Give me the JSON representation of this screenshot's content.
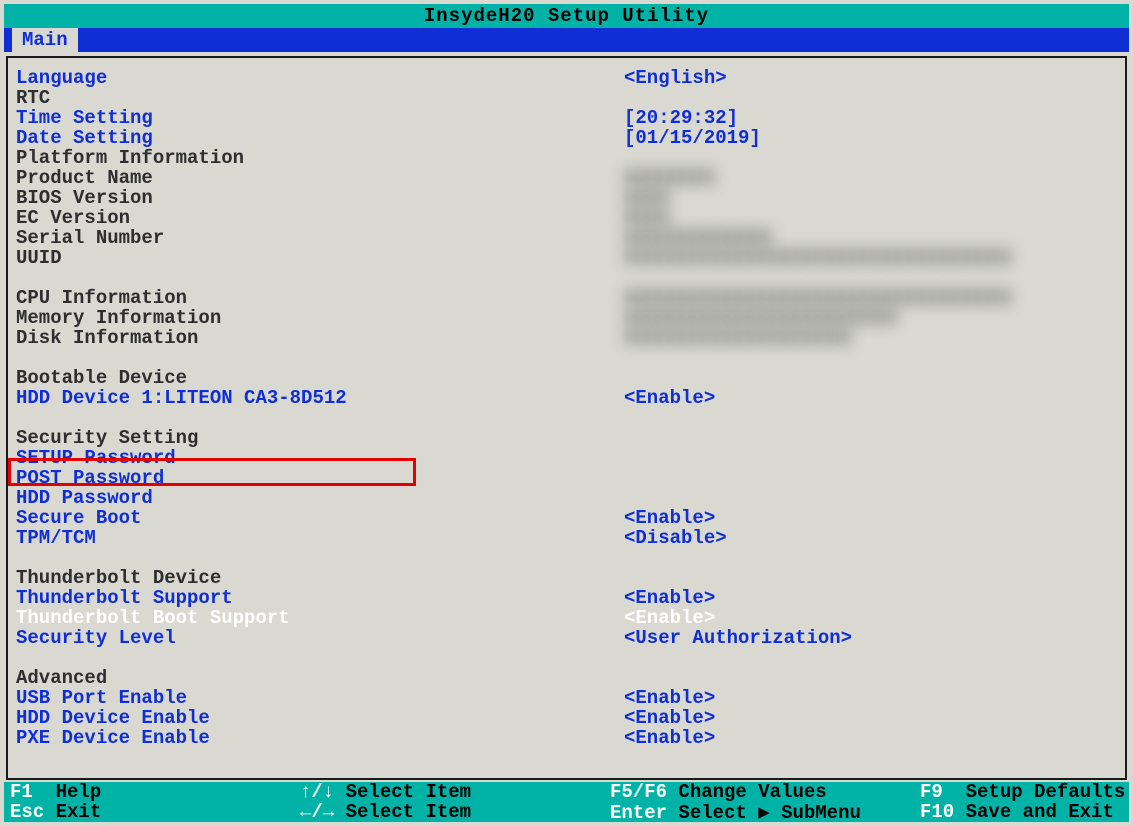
{
  "title": "InsydeH20 Setup Utility",
  "tab": "Main",
  "rows": [
    {
      "label": "Language",
      "value": "<English>",
      "labelClass": "c-blue",
      "valueClass": "c-blue",
      "interact": true
    },
    {
      "label": "RTC",
      "value": "",
      "labelClass": "c-gray",
      "valueClass": "c-gray",
      "interact": false
    },
    {
      "label": "Time Setting",
      "value": "[20:29:32]",
      "labelClass": "c-blue",
      "valueClass": "c-blue",
      "interact": true
    },
    {
      "label": "Date Setting",
      "value": "[01/15/2019]",
      "labelClass": "c-blue",
      "valueClass": "c-blue",
      "interact": true
    },
    {
      "label": "Platform Information",
      "value": "",
      "labelClass": "c-gray",
      "valueClass": "c-gray",
      "interact": false
    },
    {
      "label": "Product Name",
      "value": "XXXXXXXX",
      "labelClass": "c-gray",
      "valueClass": "blur",
      "interact": false
    },
    {
      "label": "BIOS Version",
      "value": "XXXX",
      "labelClass": "c-gray",
      "valueClass": "blur",
      "interact": false
    },
    {
      "label": "EC Version",
      "value": "XXXX",
      "labelClass": "c-gray",
      "valueClass": "blur",
      "interact": false
    },
    {
      "label": "Serial Number",
      "value": "XXXXXXXXXXXXX",
      "labelClass": "c-gray",
      "valueClass": "blur",
      "interact": false
    },
    {
      "label": "UUID",
      "value": "XXXXXXXXXXXXXXXXXXXXXXXXXXXXXXXXXX",
      "labelClass": "c-gray",
      "valueClass": "blur",
      "interact": false
    },
    {
      "label": "",
      "value": "",
      "labelClass": "c-gray",
      "valueClass": "c-gray",
      "interact": false
    },
    {
      "label": "CPU Information",
      "value": "XXXXXXXXXXXXXXXXXXXXXXXXXXXXXXXXXX",
      "labelClass": "c-gray",
      "valueClass": "blur",
      "interact": false
    },
    {
      "label": "Memory Information",
      "value": "XXXXXXXXXXXXXXXXXXXXXXXX",
      "labelClass": "c-gray",
      "valueClass": "blur",
      "interact": false
    },
    {
      "label": "Disk Information",
      "value": "XXXXXXXXXXXXXXXXXXXX",
      "labelClass": "c-gray",
      "valueClass": "blur",
      "interact": false
    },
    {
      "label": "",
      "value": "",
      "labelClass": "c-gray",
      "valueClass": "c-gray",
      "interact": false
    },
    {
      "label": "Bootable Device",
      "value": "",
      "labelClass": "c-gray",
      "valueClass": "c-gray",
      "interact": false
    },
    {
      "label": "HDD Device 1:LITEON CA3-8D512",
      "value": "<Enable>",
      "labelClass": "c-blue",
      "valueClass": "c-blue",
      "interact": true
    },
    {
      "label": "",
      "value": "",
      "labelClass": "c-gray",
      "valueClass": "c-gray",
      "interact": false
    },
    {
      "label": "Security Setting",
      "value": "",
      "labelClass": "c-gray",
      "valueClass": "c-gray",
      "interact": false
    },
    {
      "label": "SETUP Password",
      "value": "",
      "labelClass": "c-blue",
      "valueClass": "c-blue",
      "interact": true
    },
    {
      "label": "POST Password",
      "value": "",
      "labelClass": "c-blue",
      "valueClass": "c-blue",
      "interact": true
    },
    {
      "label": "HDD Password",
      "value": "",
      "labelClass": "c-blue",
      "valueClass": "c-blue",
      "interact": true
    },
    {
      "label": "Secure Boot",
      "value": "<Enable>",
      "labelClass": "c-blue",
      "valueClass": "c-blue",
      "interact": true
    },
    {
      "label": "TPM/TCM",
      "value": "<Disable>",
      "labelClass": "c-blue",
      "valueClass": "c-blue",
      "interact": true
    },
    {
      "label": "",
      "value": "",
      "labelClass": "c-gray",
      "valueClass": "c-gray",
      "interact": false
    },
    {
      "label": "Thunderbolt Device",
      "value": "",
      "labelClass": "c-gray",
      "valueClass": "c-gray",
      "interact": false
    },
    {
      "label": "Thunderbolt Support",
      "value": "<Enable>",
      "labelClass": "c-blue",
      "valueClass": "c-blue",
      "interact": true
    },
    {
      "label": "Thunderbolt Boot Support",
      "value": "<Enable>",
      "labelClass": "c-white",
      "valueClass": "c-white",
      "interact": true
    },
    {
      "label": "Security Level",
      "value": "<User Authorization>",
      "labelClass": "c-blue",
      "valueClass": "c-blue",
      "interact": true
    },
    {
      "label": "",
      "value": "",
      "labelClass": "c-gray",
      "valueClass": "c-gray",
      "interact": false
    },
    {
      "label": "Advanced",
      "value": "",
      "labelClass": "c-gray",
      "valueClass": "c-gray",
      "interact": false
    },
    {
      "label": "USB Port Enable",
      "value": "<Enable>",
      "labelClass": "c-blue",
      "valueClass": "c-blue",
      "interact": true
    },
    {
      "label": "HDD Device Enable",
      "value": "<Enable>",
      "labelClass": "c-blue",
      "valueClass": "c-blue",
      "interact": true
    },
    {
      "label": "PXE Device Enable",
      "value": "<Enable>",
      "labelClass": "c-blue",
      "valueClass": "c-blue",
      "interact": true
    }
  ],
  "highlight_row_index": 20,
  "footer": {
    "f1": "F1",
    "help": "Help",
    "esc": "Esc",
    "exit": "Exit",
    "updown": "↑/↓",
    "select_item1": "Select Item",
    "leftright": "←/→",
    "select_item2": "Select Item",
    "f5f6": "F5/F6",
    "change_values": "Change Values",
    "enter": "Enter",
    "select_submenu": "Select ▶ SubMenu",
    "f9": "F9",
    "setup_defaults": "Setup Defaults",
    "f10": "F10",
    "save_exit": "Save and Exit"
  }
}
